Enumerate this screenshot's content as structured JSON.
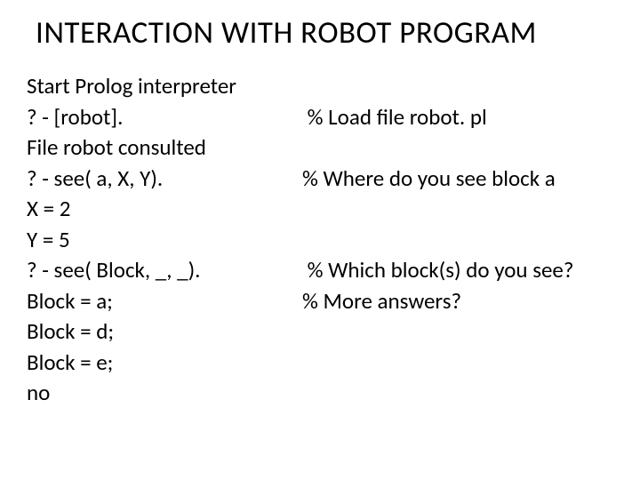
{
  "title": "INTERACTION WITH ROBOT PROGRAM",
  "lines": [
    {
      "left": "Start Prolog interpreter",
      "right": ""
    },
    {
      "left": "? - [robot].",
      "right": " % Load file robot. pl"
    },
    {
      "left": "File robot consulted",
      "right": ""
    },
    {
      "left": "? - see( a, X, Y).",
      "right": "% Where do you see block a"
    },
    {
      "left": "X = 2",
      "right": ""
    },
    {
      "left": "Y = 5",
      "right": ""
    },
    {
      "left": "? - see( Block, _, _).",
      "right": " % Which block(s) do you see?"
    },
    {
      "left": "Block = a;",
      "right": "% More answers?"
    },
    {
      "left": "Block = d;",
      "right": ""
    },
    {
      "left": "Block = e;",
      "right": ""
    },
    {
      "left": "no",
      "right": ""
    }
  ]
}
